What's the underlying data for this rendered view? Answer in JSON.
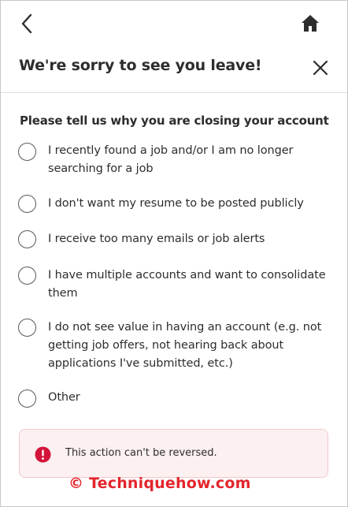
{
  "topbar": {
    "back_icon": "chevron-left-icon",
    "home_icon": "home-icon"
  },
  "header": {
    "title": "We're sorry to see you leave!",
    "close_icon": "close-icon"
  },
  "form": {
    "question": "Please tell us why you are closing your account",
    "options": [
      {
        "label": "I recently found a job and/or I am no longer searching for a job",
        "selected": false
      },
      {
        "label": "I don't want my resume to be posted publicly",
        "selected": false
      },
      {
        "label": "I receive too many emails or job alerts",
        "selected": false
      },
      {
        "label": "I have multiple accounts and want to consolidate them",
        "selected": false
      },
      {
        "label": "I do not see value in having an account (e.g. not getting job offers, not hearing back about applications I've submitted, etc.)",
        "selected": false
      },
      {
        "label": "Other",
        "selected": false
      }
    ]
  },
  "warning": {
    "icon": "alert-circle-icon",
    "text": "This action can't be reversed.",
    "color": "#d4153a"
  },
  "watermark": {
    "text": "© Techniquehow.com",
    "color": "#e3252c"
  }
}
